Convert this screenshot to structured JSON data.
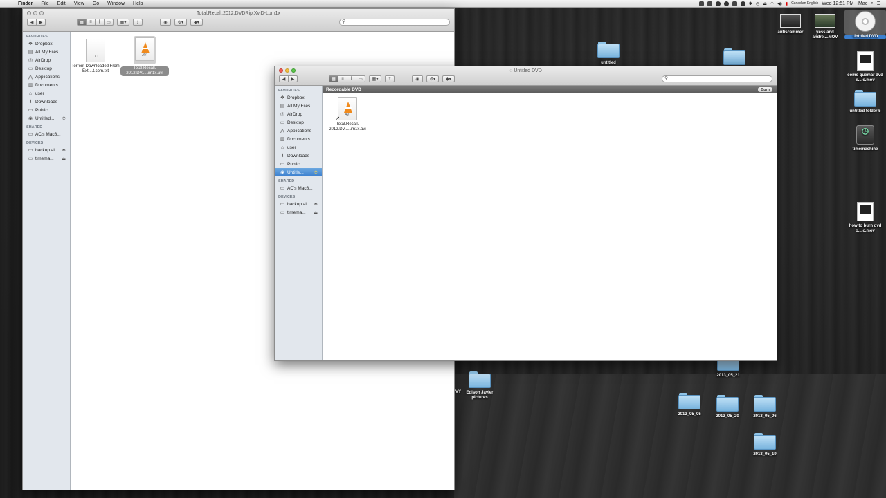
{
  "menubar": {
    "apple": "",
    "items": [
      "Finder",
      "File",
      "Edit",
      "View",
      "Go",
      "Window",
      "Help"
    ],
    "input_source": "Canadian English",
    "clock": "Wed 12:51 PM",
    "computer": "iMac"
  },
  "back_window": {
    "title": "Total.Recall.2012.DVDRip.XviD-Lum1x",
    "sidebar": {
      "favorites_header": "FAVORITES",
      "favorites": [
        "Dropbox",
        "All My Files",
        "AirDrop",
        "Desktop",
        "Applications",
        "Documents",
        "user",
        "Downloads",
        "Public",
        "Untitled..."
      ],
      "shared_header": "SHARED",
      "shared": [
        "AC's Mac8..."
      ],
      "devices_header": "DEVICES",
      "devices": [
        "backup all",
        "timema..."
      ]
    },
    "files": [
      {
        "name": "Torrent Downloaded From Ext....t.com.txt",
        "ext": "TXT"
      },
      {
        "name": "Total.Recall. 2012.DV....um1x.avi",
        "ext": "AVI"
      }
    ]
  },
  "front_window": {
    "title": "Untitled DVD",
    "sidebar": {
      "favorites_header": "FAVORITES",
      "favorites": [
        "Dropbox",
        "All My Files",
        "AirDrop",
        "Desktop",
        "Applications",
        "Documents",
        "user",
        "Downloads",
        "Public",
        "Untitle..."
      ],
      "shared_header": "SHARED",
      "shared": [
        "AC's Mac8..."
      ],
      "devices_header": "DEVICES",
      "devices": [
        "backup all",
        "timema..."
      ]
    },
    "burn_bar": {
      "label": "Recordable DVD",
      "button": "Burn"
    },
    "files": [
      {
        "name": "Total.Recall. 2012.DV....um1x.avi",
        "ext": "AVI"
      }
    ]
  },
  "desktop": {
    "icons": {
      "antiscammer": "antiscammer",
      "yess": "yess and andre....MOV",
      "dvd": "Untitled DVD",
      "como": "como quemar dvd e....c.mov",
      "folder5": "untitled folder 5",
      "timemachine": "timemachine",
      "howto": "how to burn dvd o....c.mov",
      "f0521": "2013_05_21",
      "edison": "Edison Javier pictures",
      "f0505": "2013_05_05",
      "f0520": "2013_05_20",
      "f0506": "2013_05_06",
      "f0519": "2013_05_19",
      "partial_top": "untitled",
      "partial_left": "VY"
    }
  }
}
